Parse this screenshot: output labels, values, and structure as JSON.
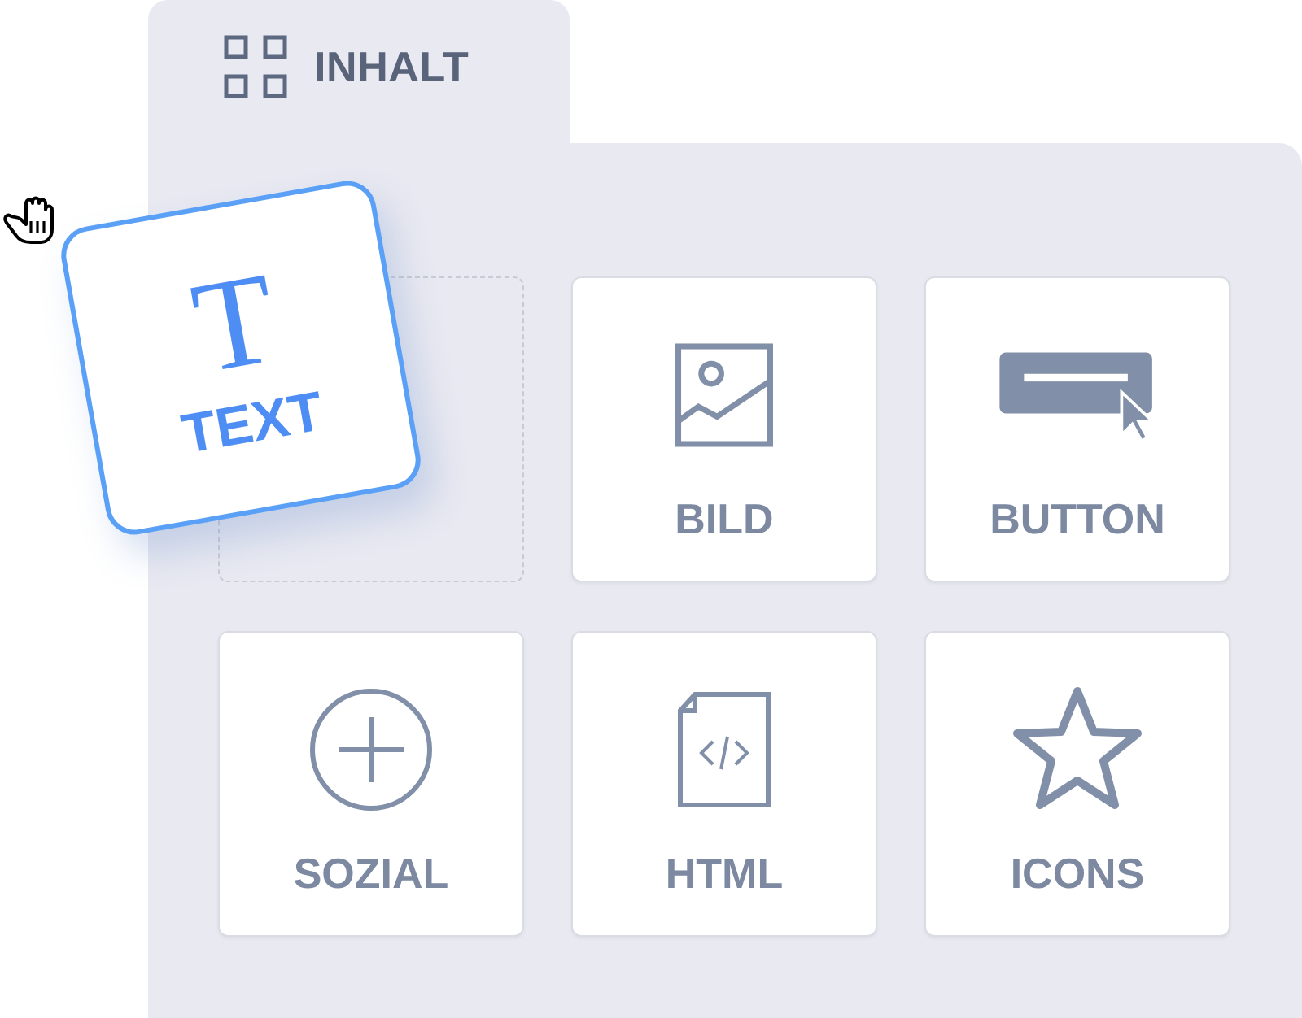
{
  "tab": {
    "label": "INHALT",
    "selected": true
  },
  "dragged": {
    "glyph": "T",
    "label": "TEXT"
  },
  "slots": [
    {
      "kind": "placeholder"
    },
    {
      "kind": "image",
      "label": "BILD"
    },
    {
      "kind": "button",
      "label": "BUTTON"
    },
    {
      "kind": "social",
      "label": "SOZIAL"
    },
    {
      "kind": "html",
      "label": "HTML"
    },
    {
      "kind": "star",
      "label": "ICONS"
    }
  ]
}
